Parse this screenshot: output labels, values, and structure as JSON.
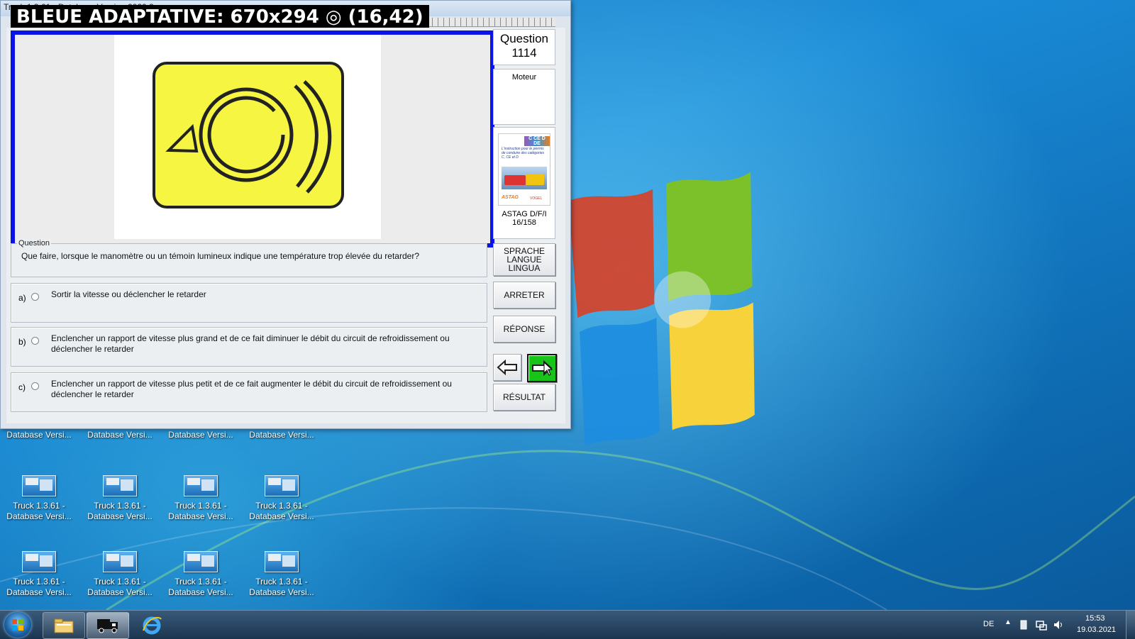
{
  "window": {
    "title": "Truck 1.3.61 - Database Version 2020.2",
    "overlay_label": "BLEUE ADAPTATIVE: 670x294 ◎ (16,42)"
  },
  "side": {
    "question_label": "Question",
    "question_number": "1114",
    "category": "Moteur",
    "book": {
      "cover_badge": "C CE D DE",
      "cover_text": "L'instruction pour le permis de conduire des catégories C, CE et D",
      "cover_logo": "ASTAG",
      "cover_logo2": "VOGEL",
      "source": "ASTAG D/F/I",
      "page": "16/158"
    },
    "buttons": {
      "language": [
        "SPRACHE",
        "LANGUE",
        "LINGUA"
      ],
      "stop": "ARRETER",
      "answer": "RÉPONSE",
      "result": "RÉSULTAT"
    },
    "nav": {
      "prev_icon": "arrow-left-icon",
      "next_icon": "arrow-right-icon",
      "next_color": "#19c419"
    }
  },
  "question": {
    "legend": "Question",
    "text": "Que faire, lorsque le manomètre ou un témoin lumineux indique une température trop élevée du retarder?"
  },
  "answers": [
    {
      "letter": "a)",
      "text": "Sortir la vitesse ou déclencher le retarder"
    },
    {
      "letter": "b)",
      "text": "Enclencher un rapport de vitesse plus grand et de ce fait diminuer le débit du circuit de refroidissement ou déclencher le retarder"
    },
    {
      "letter": "c)",
      "text": "Enclencher un rapport de vitesse plus petit et de ce fait augmenter le débit du circuit de refroidissement ou déclencher le retarder"
    }
  ],
  "desktop_icons": [
    {
      "line1": "",
      "line2": "Database Versi..."
    },
    {
      "line1": "",
      "line2": "Database Versi..."
    },
    {
      "line1": "",
      "line2": "Database Versi..."
    },
    {
      "line1": "",
      "line2": "Database Versi..."
    },
    {
      "line1": "Truck 1.3.61 -",
      "line2": "Database Versi..."
    },
    {
      "line1": "Truck 1.3.61 -",
      "line2": "Database Versi..."
    },
    {
      "line1": "Truck 1.3.61 -",
      "line2": "Database Versi..."
    },
    {
      "line1": "Truck 1.3.61 -",
      "line2": "Database Versi..."
    },
    {
      "line1": "Truck 1.3.61 -",
      "line2": "Database Versi..."
    },
    {
      "line1": "Truck 1.3.61 -",
      "line2": "Database Versi..."
    },
    {
      "line1": "Truck 1.3.61 -",
      "line2": "Database Versi..."
    },
    {
      "line1": "Truck 1.3.61 -",
      "line2": "Database Versi..."
    }
  ],
  "taskbar": {
    "apps": [
      "file-explorer-icon",
      "truck-app-icon",
      "internet-explorer-icon"
    ],
    "language": "DE",
    "time": "15:53",
    "date": "19.03.2021"
  },
  "colors": {
    "image_frame": "#0a14e6",
    "warning_yellow": "#f5f542"
  }
}
